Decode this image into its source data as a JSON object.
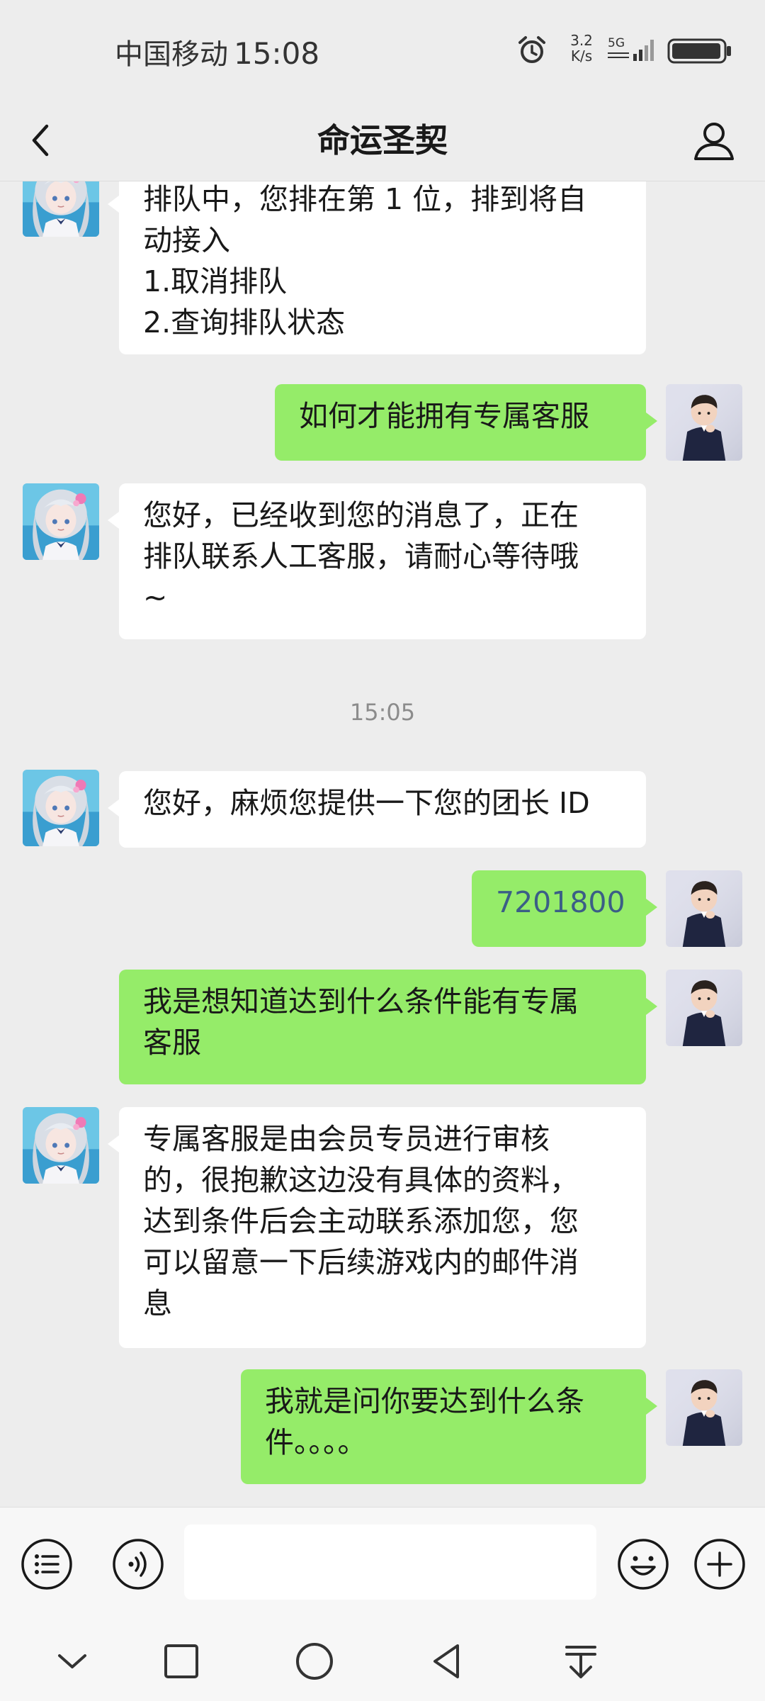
{
  "status_bar": {
    "carrier": "中国移动",
    "time": "15:08",
    "net_speed_value": "3.2",
    "net_speed_unit": "K/s",
    "network": "5G",
    "icons": [
      "alarm-icon",
      "signal-icon",
      "battery-icon"
    ]
  },
  "header": {
    "title": "命运圣契",
    "left_icon": "back-chevron-icon",
    "right_icon": "profile-icon"
  },
  "chat": {
    "messages": [
      {
        "from": "bot",
        "text": "排队中，您排在第 1 位，排到将自\n动接入\n1.取消排队\n2.查询排队状态"
      },
      {
        "from": "user",
        "text": "如何才能拥有专属客服"
      },
      {
        "from": "bot",
        "text": "您好，已经收到您的消息了，正在\n排队联系人工客服，请耐心等待哦\n~"
      },
      {
        "from": "bot",
        "text": "您好，麻烦您提供一下您的团长 ID"
      },
      {
        "from": "user",
        "text": "7201800"
      },
      {
        "from": "user",
        "text": "我是想知道达到什么条件能有专属\n客服"
      },
      {
        "from": "bot",
        "text": "专属客服是由会员专员进行审核\n的，很抱歉这边没有具体的资料，\n达到条件后会主动联系添加您，您\n可以留意一下后续游戏内的邮件消\n息"
      },
      {
        "from": "user",
        "text": "我就是问你要达到什么条\n件。。。。"
      }
    ],
    "timestamp": "15:05"
  },
  "input_bar": {
    "message_value": "",
    "icons": [
      "menu-list-icon",
      "voice-icon",
      "emoji-icon",
      "plus-icon"
    ]
  },
  "system_nav": {
    "icons": [
      "chevron-down-icon",
      "recents-square-icon",
      "home-circle-icon",
      "back-triangle-icon",
      "pull-down-icon"
    ]
  },
  "colors": {
    "background": "#ededed",
    "outgoing_bubble": "#95ec69",
    "incoming_bubble": "#ffffff",
    "timestamp_text": "#8c8c8c"
  }
}
